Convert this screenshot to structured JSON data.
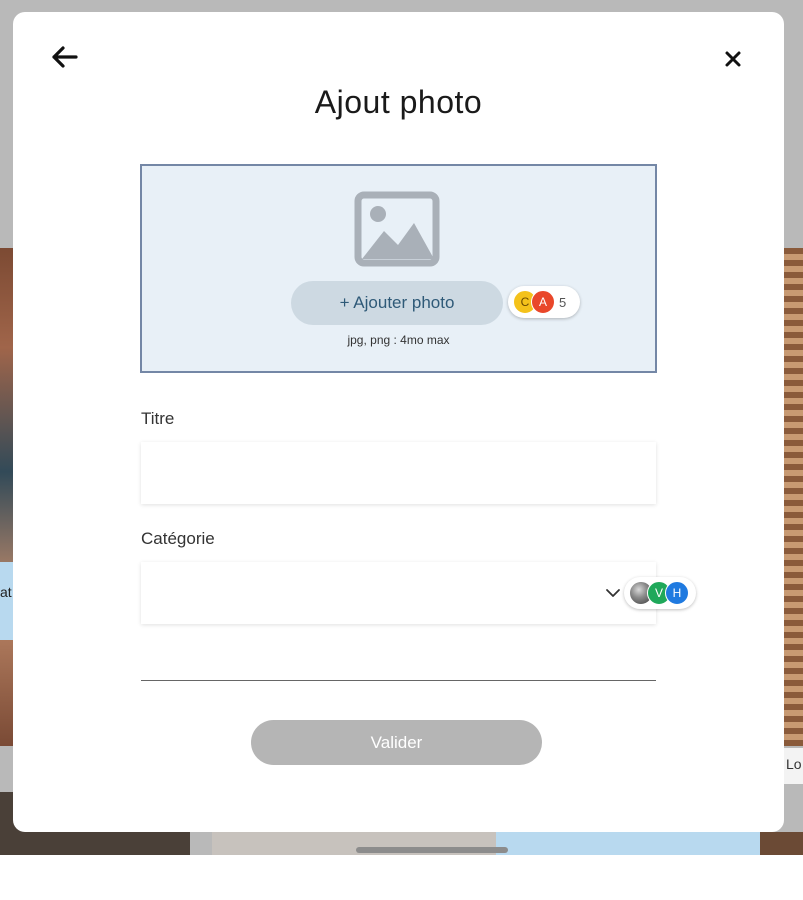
{
  "background": {
    "left_caption": "at l'A",
    "right_caption": "Lo"
  },
  "modal": {
    "title": "Ajout photo",
    "back_icon": "arrow-left-icon",
    "close_icon": "close-icon"
  },
  "upload": {
    "icon": "image-placeholder-icon",
    "add_button_label": "+ Ajouter photo",
    "hint": "jpg, png : 4mo max",
    "border_color": "#7487a6",
    "background_color": "#e8f0f7"
  },
  "presence_upload": {
    "avatars": [
      "C",
      "A"
    ],
    "count": "5"
  },
  "presence_category": {
    "avatars": [
      "V",
      "H"
    ]
  },
  "form": {
    "title_label": "Titre",
    "title_value": "",
    "category_label": "Catégorie",
    "category_value": "",
    "submit_label": "Valider",
    "submit_color": "#b5b5b5"
  }
}
